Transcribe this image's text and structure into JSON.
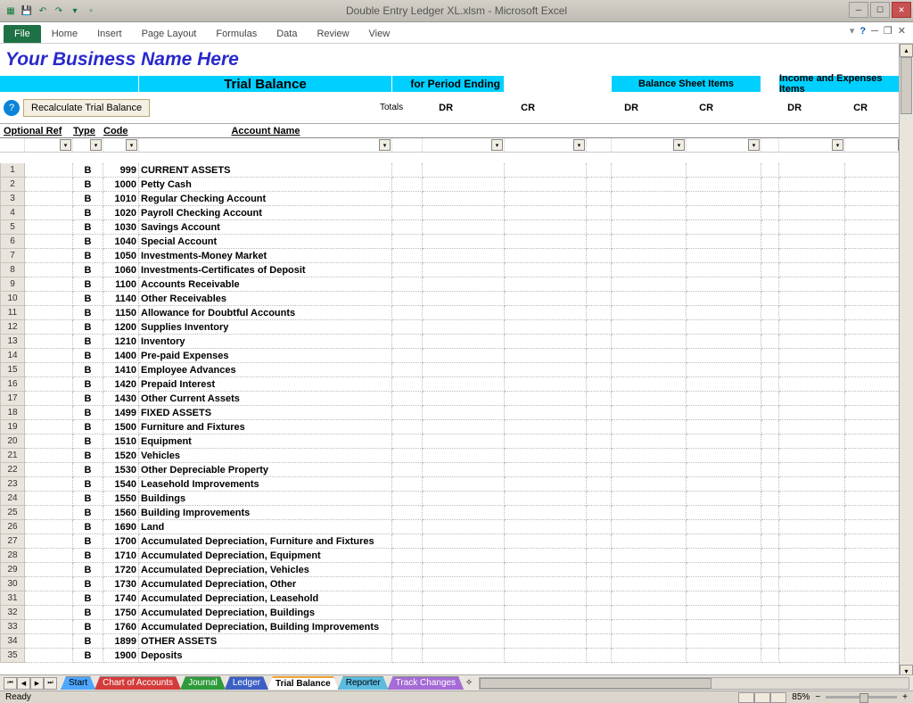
{
  "title": "Double Entry Ledger XL.xlsm  -  Microsoft Excel",
  "ribbon": {
    "file": "File",
    "tabs": [
      "Home",
      "Insert",
      "Page Layout",
      "Formulas",
      "Data",
      "Review",
      "View"
    ]
  },
  "business_heading": "Your Business Name Here",
  "banner": {
    "trial": "Trial Balance",
    "period": "for Period Ending",
    "bsheet": "Balance Sheet Items",
    "income": "Income and Expenses Items"
  },
  "buttons": {
    "recalc": "Recalculate Trial Balance"
  },
  "headers": {
    "optref": "Optional Ref",
    "type": "Type",
    "code": "Code",
    "acct": "Account Name",
    "totals": "Totals",
    "dr": "DR",
    "cr": "CR"
  },
  "rows": [
    {
      "n": "1",
      "t": "B",
      "c": "999",
      "a": "CURRENT ASSETS",
      "b": true
    },
    {
      "n": "2",
      "t": "B",
      "c": "1000",
      "a": "Petty Cash",
      "b": true
    },
    {
      "n": "3",
      "t": "B",
      "c": "1010",
      "a": "Regular Checking Account",
      "b": true
    },
    {
      "n": "4",
      "t": "B",
      "c": "1020",
      "a": "Payroll Checking Account",
      "b": true
    },
    {
      "n": "5",
      "t": "B",
      "c": "1030",
      "a": "Savings Account",
      "b": true
    },
    {
      "n": "6",
      "t": "B",
      "c": "1040",
      "a": "Special Account",
      "b": true
    },
    {
      "n": "7",
      "t": "B",
      "c": "1050",
      "a": "Investments-Money Market",
      "b": true
    },
    {
      "n": "8",
      "t": "B",
      "c": "1060",
      "a": "Investments-Certificates of Deposit",
      "b": true
    },
    {
      "n": "9",
      "t": "B",
      "c": "1100",
      "a": "Accounts Receivable",
      "b": true
    },
    {
      "n": "10",
      "t": "B",
      "c": "1140",
      "a": "Other Receivables",
      "b": true
    },
    {
      "n": "11",
      "t": "B",
      "c": "1150",
      "a": "Allowance for Doubtful Accounts",
      "b": true
    },
    {
      "n": "12",
      "t": "B",
      "c": "1200",
      "a": "Supplies Inventory",
      "b": true
    },
    {
      "n": "13",
      "t": "B",
      "c": "1210",
      "a": "Inventory",
      "b": true
    },
    {
      "n": "14",
      "t": "B",
      "c": "1400",
      "a": "Pre-paid Expenses",
      "b": true
    },
    {
      "n": "15",
      "t": "B",
      "c": "1410",
      "a": "Employee Advances",
      "b": true
    },
    {
      "n": "16",
      "t": "B",
      "c": "1420",
      "a": "Prepaid Interest",
      "b": true
    },
    {
      "n": "17",
      "t": "B",
      "c": "1430",
      "a": "Other Current Assets",
      "b": true
    },
    {
      "n": "18",
      "t": "B",
      "c": "1499",
      "a": "FIXED ASSETS",
      "b": true
    },
    {
      "n": "19",
      "t": "B",
      "c": "1500",
      "a": "Furniture and Fixtures",
      "b": true
    },
    {
      "n": "20",
      "t": "B",
      "c": "1510",
      "a": "Equipment",
      "b": true
    },
    {
      "n": "21",
      "t": "B",
      "c": "1520",
      "a": "Vehicles",
      "b": true
    },
    {
      "n": "22",
      "t": "B",
      "c": "1530",
      "a": "Other Depreciable Property",
      "b": true
    },
    {
      "n": "23",
      "t": "B",
      "c": "1540",
      "a": "Leasehold Improvements",
      "b": true
    },
    {
      "n": "24",
      "t": "B",
      "c": "1550",
      "a": "Buildings",
      "b": true
    },
    {
      "n": "25",
      "t": "B",
      "c": "1560",
      "a": "Building Improvements",
      "b": true
    },
    {
      "n": "26",
      "t": "B",
      "c": "1690",
      "a": "Land",
      "b": true
    },
    {
      "n": "27",
      "t": "B",
      "c": "1700",
      "a": "Accumulated Depreciation, Furniture and Fixtures",
      "b": true
    },
    {
      "n": "28",
      "t": "B",
      "c": "1710",
      "a": "Accumulated Depreciation, Equipment",
      "b": true
    },
    {
      "n": "29",
      "t": "B",
      "c": "1720",
      "a": "Accumulated Depreciation, Vehicles",
      "b": true
    },
    {
      "n": "30",
      "t": "B",
      "c": "1730",
      "a": "Accumulated Depreciation, Other",
      "b": true
    },
    {
      "n": "31",
      "t": "B",
      "c": "1740",
      "a": "Accumulated Depreciation, Leasehold",
      "b": true
    },
    {
      "n": "32",
      "t": "B",
      "c": "1750",
      "a": "Accumulated Depreciation, Buildings",
      "b": true
    },
    {
      "n": "33",
      "t": "B",
      "c": "1760",
      "a": "Accumulated Depreciation, Building Improvements",
      "b": true
    },
    {
      "n": "34",
      "t": "B",
      "c": "1899",
      "a": "OTHER ASSETS",
      "b": true
    },
    {
      "n": "35",
      "t": "B",
      "c": "1900",
      "a": "Deposits",
      "b": true
    }
  ],
  "sheettabs": [
    {
      "label": "Start",
      "cls": "s-start"
    },
    {
      "label": "Chart of Accounts",
      "cls": "s-chart"
    },
    {
      "label": "Journal",
      "cls": "s-journal"
    },
    {
      "label": "Ledger",
      "cls": "s-ledger"
    },
    {
      "label": "Trial Balance",
      "cls": "active"
    },
    {
      "label": "Reporter",
      "cls": "s-report"
    },
    {
      "label": "Track Changes",
      "cls": "s-track"
    }
  ],
  "status": {
    "ready": "Ready",
    "zoom": "85%"
  }
}
